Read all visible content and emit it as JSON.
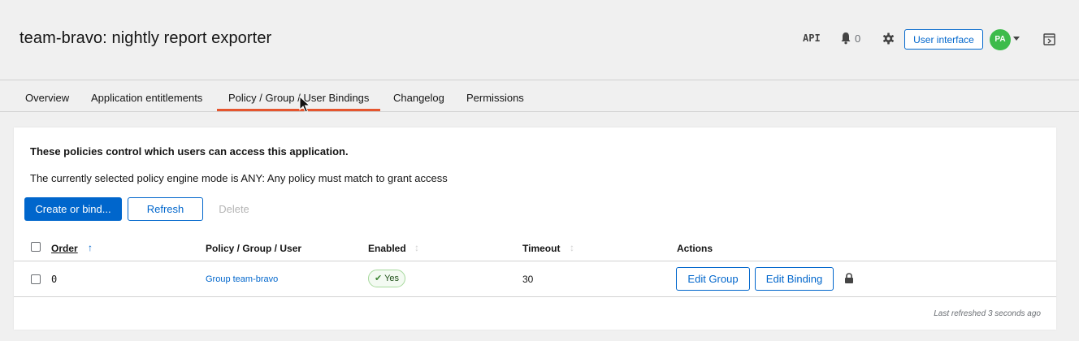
{
  "header": {
    "title": "team-bravo: nightly report exporter",
    "api_label": "API",
    "notification_count": "0",
    "user_interface_label": "User interface",
    "avatar_initials": "PA"
  },
  "tabs": [
    {
      "label": "Overview"
    },
    {
      "label": "Application entitlements"
    },
    {
      "label": "Policy / Group / User Bindings",
      "active": true
    },
    {
      "label": "Changelog"
    },
    {
      "label": "Permissions"
    }
  ],
  "main": {
    "description_bold": "These policies control which users can access this application.",
    "description": "The currently selected policy engine mode is ANY: Any policy must match to grant access",
    "toolbar": {
      "create_label": "Create or bind...",
      "refresh_label": "Refresh",
      "delete_label": "Delete"
    },
    "table": {
      "headers": {
        "order": "Order",
        "policy": "Policy / Group / User",
        "enabled": "Enabled",
        "timeout": "Timeout",
        "actions": "Actions"
      },
      "rows": [
        {
          "order": "0",
          "policy": "Group team-bravo",
          "enabled": "Yes",
          "timeout": "30",
          "edit_group_label": "Edit Group",
          "edit_binding_label": "Edit Binding"
        }
      ]
    },
    "last_refreshed": "Last refreshed 3 seconds ago"
  },
  "colors": {
    "accent": "#0066cc",
    "active_tab": "#e5552e",
    "avatar": "#3dbb4b",
    "enabled_badge_border": "#a6d99c"
  },
  "icons": [
    "bell-icon",
    "gear-icon",
    "chevron-down-icon",
    "drawer-icon",
    "sort-up-icon",
    "sort-icon",
    "check-icon",
    "lock-icon"
  ]
}
